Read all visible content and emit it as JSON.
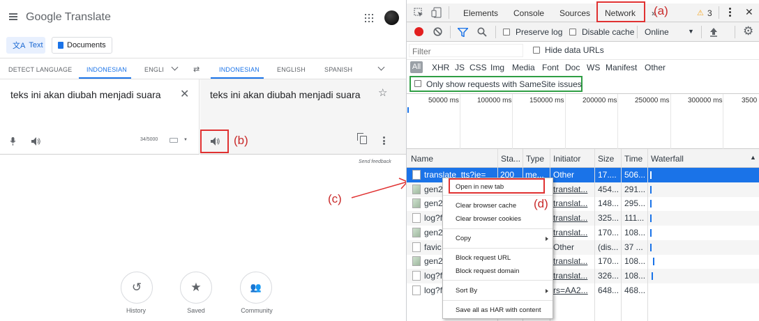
{
  "translate": {
    "app_title": "Google Translate",
    "modes": {
      "text": "Text",
      "documents": "Documents"
    },
    "source_langs": [
      "DETECT LANGUAGE",
      "INDONESIAN",
      "ENGLI"
    ],
    "target_langs": [
      "INDONESIAN",
      "ENGLISH",
      "SPANISH"
    ],
    "source_text": "teks ini akan diubah menjadi suara",
    "target_text": "teks ini akan diubah menjadi suara",
    "char_count": "34/5000",
    "send_feedback": "Send feedback",
    "bottom": [
      {
        "label": "History",
        "icon": "history-icon"
      },
      {
        "label": "Saved",
        "icon": "star-icon"
      },
      {
        "label": "Community",
        "icon": "community-icon"
      }
    ]
  },
  "annotations": {
    "a": "(a)",
    "b": "(b)",
    "c": "(c)",
    "d": "(d)"
  },
  "devtools": {
    "tabs": [
      "Elements",
      "Console",
      "Sources",
      "Network"
    ],
    "more_tabs": "»",
    "warning_count": "3",
    "toolbar": {
      "preserve_log": "Preserve log",
      "disable_cache": "Disable cache",
      "throttle": "Online"
    },
    "filter": {
      "placeholder": "Filter",
      "hide_data_urls": "Hide data URLs"
    },
    "types": [
      "All",
      "XHR",
      "JS",
      "CSS",
      "Img",
      "Media",
      "Font",
      "Doc",
      "WS",
      "Manifest",
      "Other"
    ],
    "samesite": "Only show requests with SameSite issues",
    "ticks": [
      "50000 ms",
      "100000 ms",
      "150000 ms",
      "200000 ms",
      "250000 ms",
      "300000 ms",
      "3500"
    ],
    "columns": {
      "name": "Name",
      "status": "Sta...",
      "type": "Type",
      "initiator": "Initiator",
      "size": "Size",
      "time": "Time",
      "waterfall": "Waterfall"
    },
    "rows": [
      {
        "name": "translate_tts?ie=",
        "status": "200",
        "type": "me...",
        "initiator": "Other",
        "size": "17....",
        "time": "506..."
      },
      {
        "name": "gen2",
        "status": "",
        "type": "",
        "initiator": "translat...",
        "size": "454...",
        "time": "291..."
      },
      {
        "name": "gen2",
        "status": "",
        "type": "",
        "initiator": "translat...",
        "size": "148...",
        "time": "295..."
      },
      {
        "name": "log?f",
        "status": "",
        "type": "",
        "initiator": "translat...",
        "size": "325...",
        "time": "111..."
      },
      {
        "name": "gen2",
        "status": "",
        "type": "",
        "initiator": "translat...",
        "size": "170...",
        "time": "108..."
      },
      {
        "name": "favic",
        "status": "",
        "type": "",
        "initiator": "Other",
        "size": "(dis...",
        "time": "37 ..."
      },
      {
        "name": "gen2",
        "status": "",
        "type": "",
        "initiator": "translat...",
        "size": "170...",
        "time": "108..."
      },
      {
        "name": "log?f",
        "status": "",
        "type": "",
        "initiator": "translat...",
        "size": "326...",
        "time": "108..."
      },
      {
        "name": "log?f",
        "status": "",
        "type": "",
        "initiator": "rs=AA2...",
        "size": "648...",
        "time": "468..."
      }
    ]
  },
  "context_menu": {
    "open_new_tab": "Open in new tab",
    "clear_cache": "Clear browser cache",
    "clear_cookies": "Clear browser cookies",
    "copy": "Copy",
    "block_url": "Block request URL",
    "block_domain": "Block request domain",
    "sort_by": "Sort By",
    "save_har": "Save all as HAR with content"
  }
}
